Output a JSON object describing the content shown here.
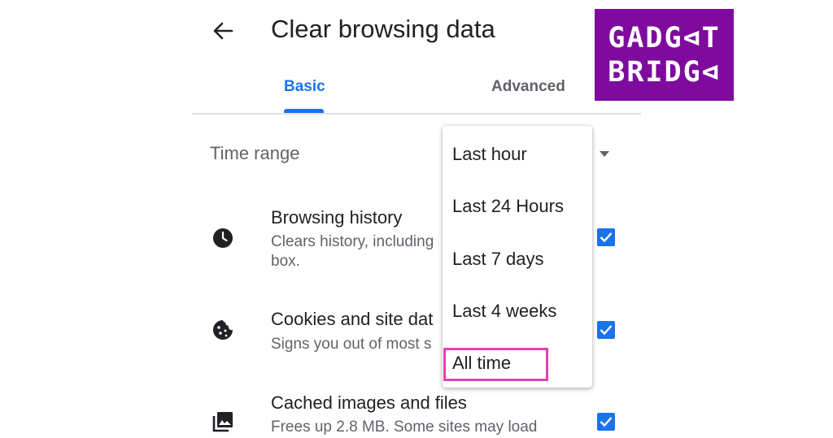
{
  "header": {
    "title": "Clear browsing data",
    "back_icon": "arrow-back-icon"
  },
  "tabs": [
    {
      "label": "Basic",
      "selected": true
    },
    {
      "label": "Advanced",
      "selected": false
    }
  ],
  "time_range": {
    "label": "Time range"
  },
  "rows": [
    {
      "icon": "clock-icon",
      "title": "Browsing history",
      "subtitle_line1": "Clears history, including",
      "subtitle_line2": "box.",
      "checked": true
    },
    {
      "icon": "cookie-icon",
      "title": "Cookies and site dat",
      "subtitle_line1": "Signs you out of most s",
      "checked": true
    },
    {
      "icon": "image-icon",
      "title": "Cached images and files",
      "subtitle_line1": "Frees up 2.8 MB. Some sites may load",
      "checked": true
    }
  ],
  "dropdown": {
    "options": [
      "Last hour",
      "Last 24 Hours",
      "Last 7 days",
      "Last 4 weeks",
      "All time"
    ],
    "highlighted": "All time"
  },
  "logo": {
    "line1": "GADG⊲T",
    "line2": "BRIDG⊲"
  },
  "colors": {
    "accent": "#1a73e8",
    "highlight_box": "#e040b3",
    "logo_bg": "#7e0b9e",
    "secondary_text": "#5f6368"
  }
}
